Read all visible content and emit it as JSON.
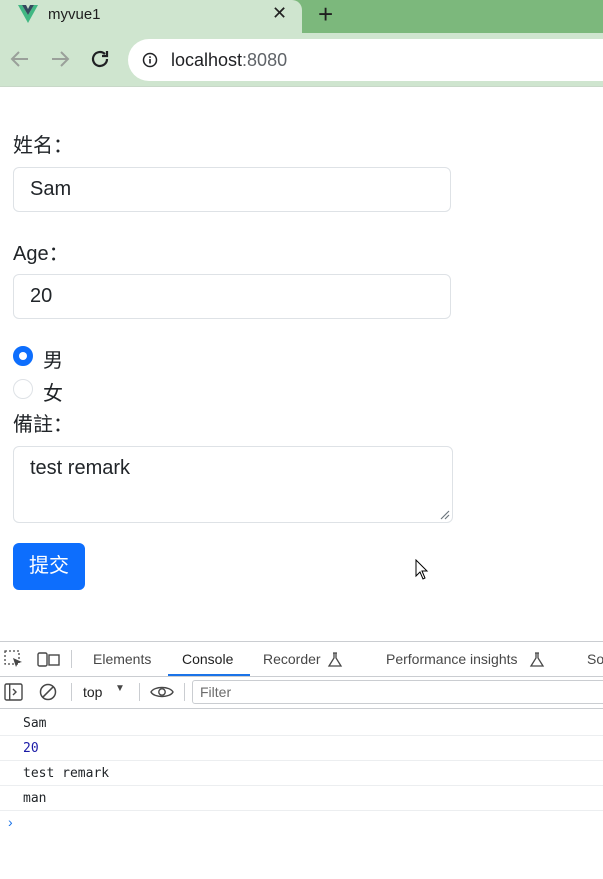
{
  "browser": {
    "tab_title": "myvue1",
    "close_glyph": "✕",
    "newtab_glyph": "+",
    "url_host": "localhost",
    "url_port": ":8080"
  },
  "form": {
    "name_label": "姓名：",
    "name_value": "Sam",
    "age_label": "Age：",
    "age_value": "20",
    "gender_options": [
      {
        "label": "男",
        "checked": true
      },
      {
        "label": "女",
        "checked": false
      }
    ],
    "remark_label": "備註：",
    "remark_value": "test remark",
    "submit_label": "提交"
  },
  "devtools": {
    "tabs": [
      "Elements",
      "Console",
      "Recorder",
      "Performance insights",
      "So"
    ],
    "active_tab": "Console",
    "context": "top",
    "filter_placeholder": "Filter",
    "logs": [
      "Sam",
      "20",
      "test remark",
      "man"
    ],
    "prompt": "›"
  },
  "colors": {
    "primary": "#0d6efd",
    "chrome_green": "#7cb87c",
    "chrome_light": "#cfe5cf"
  }
}
